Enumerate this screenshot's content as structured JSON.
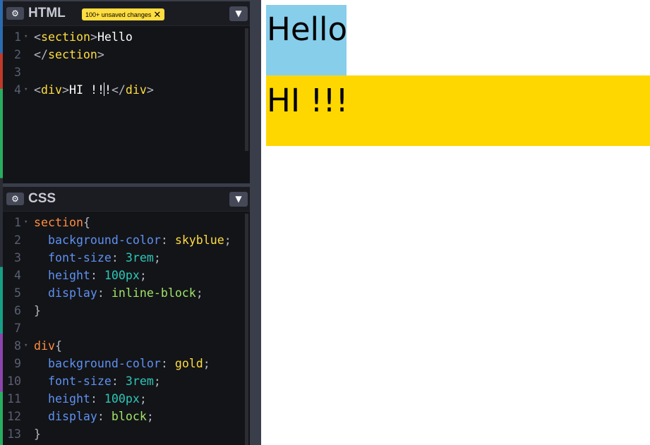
{
  "html_panel": {
    "title": "HTML",
    "badge": "100+ unsaved changes",
    "badge_close": "✕",
    "gear_icon": "gear-icon",
    "collapse_icon": "chevron-down-icon",
    "lines": [
      {
        "n": "1",
        "fold": true,
        "tokens": [
          [
            "tok-punc",
            "<"
          ],
          [
            "tok-tag",
            "section"
          ],
          [
            "tok-punc",
            ">"
          ],
          [
            "tok-text",
            "Hello"
          ]
        ]
      },
      {
        "n": "2",
        "fold": false,
        "tokens": [
          [
            "tok-punc",
            "</"
          ],
          [
            "tok-tag",
            "section"
          ],
          [
            "tok-punc",
            ">"
          ]
        ]
      },
      {
        "n": "3",
        "fold": false,
        "tokens": []
      },
      {
        "n": "4",
        "fold": true,
        "tokens": [
          [
            "tok-punc",
            "<"
          ],
          [
            "tok-tag",
            "div"
          ],
          [
            "tok-punc",
            ">"
          ],
          [
            "tok-text",
            "HI !!"
          ],
          [
            "caret",
            ""
          ],
          [
            "tok-text",
            "!"
          ],
          [
            "tok-punc",
            "</"
          ],
          [
            "tok-tag",
            "div"
          ],
          [
            "tok-punc",
            ">"
          ]
        ]
      }
    ]
  },
  "css_panel": {
    "title": "CSS",
    "gear_icon": "gear-icon",
    "collapse_icon": "chevron-down-icon",
    "lines": [
      {
        "n": "1",
        "fold": true,
        "tokens": [
          [
            "tok-sel",
            "section"
          ],
          [
            "tok-punc",
            "{"
          ]
        ]
      },
      {
        "n": "2",
        "fold": false,
        "tokens": [
          [
            "tok-text",
            "  "
          ],
          [
            "tok-prop",
            "background-color"
          ],
          [
            "tok-punc",
            ": "
          ],
          [
            "tok-val",
            "skyblue"
          ],
          [
            "tok-punc",
            ";"
          ]
        ]
      },
      {
        "n": "3",
        "fold": false,
        "tokens": [
          [
            "tok-text",
            "  "
          ],
          [
            "tok-prop",
            "font-size"
          ],
          [
            "tok-punc",
            ": "
          ],
          [
            "tok-num",
            "3rem"
          ],
          [
            "tok-punc",
            ";"
          ]
        ]
      },
      {
        "n": "4",
        "fold": false,
        "tokens": [
          [
            "tok-text",
            "  "
          ],
          [
            "tok-prop",
            "height"
          ],
          [
            "tok-punc",
            ": "
          ],
          [
            "tok-num",
            "100px"
          ],
          [
            "tok-punc",
            ";"
          ]
        ]
      },
      {
        "n": "5",
        "fold": false,
        "tokens": [
          [
            "tok-text",
            "  "
          ],
          [
            "tok-prop",
            "display"
          ],
          [
            "tok-punc",
            ": "
          ],
          [
            "tok-kw",
            "inline-block"
          ],
          [
            "tok-punc",
            ";"
          ]
        ]
      },
      {
        "n": "6",
        "fold": false,
        "tokens": [
          [
            "tok-punc",
            "}"
          ]
        ]
      },
      {
        "n": "7",
        "fold": false,
        "tokens": []
      },
      {
        "n": "8",
        "fold": true,
        "tokens": [
          [
            "tok-sel",
            "div"
          ],
          [
            "tok-punc",
            "{"
          ]
        ]
      },
      {
        "n": "9",
        "fold": false,
        "tokens": [
          [
            "tok-text",
            "  "
          ],
          [
            "tok-prop",
            "background-color"
          ],
          [
            "tok-punc",
            ": "
          ],
          [
            "tok-val",
            "gold"
          ],
          [
            "tok-punc",
            ";"
          ]
        ]
      },
      {
        "n": "10",
        "fold": false,
        "tokens": [
          [
            "tok-text",
            "  "
          ],
          [
            "tok-prop",
            "font-size"
          ],
          [
            "tok-punc",
            ": "
          ],
          [
            "tok-num",
            "3rem"
          ],
          [
            "tok-punc",
            ";"
          ]
        ]
      },
      {
        "n": "11",
        "fold": false,
        "tokens": [
          [
            "tok-text",
            "  "
          ],
          [
            "tok-prop",
            "height"
          ],
          [
            "tok-punc",
            ": "
          ],
          [
            "tok-num",
            "100px"
          ],
          [
            "tok-punc",
            ";"
          ]
        ]
      },
      {
        "n": "12",
        "fold": false,
        "tokens": [
          [
            "tok-text",
            "  "
          ],
          [
            "tok-prop",
            "display"
          ],
          [
            "tok-punc",
            ": "
          ],
          [
            "tok-kw",
            "block"
          ],
          [
            "tok-punc",
            ";"
          ]
        ]
      },
      {
        "n": "13",
        "fold": false,
        "tokens": [
          [
            "tok-punc",
            "}"
          ]
        ]
      }
    ]
  },
  "preview": {
    "section_text": "Hello",
    "div_text": "HI !!!",
    "section_color": "#87ceeb",
    "div_color": "#ffd700"
  },
  "colors": {
    "editor_bg": "#131417",
    "accent_badge": "#ffdd40"
  }
}
